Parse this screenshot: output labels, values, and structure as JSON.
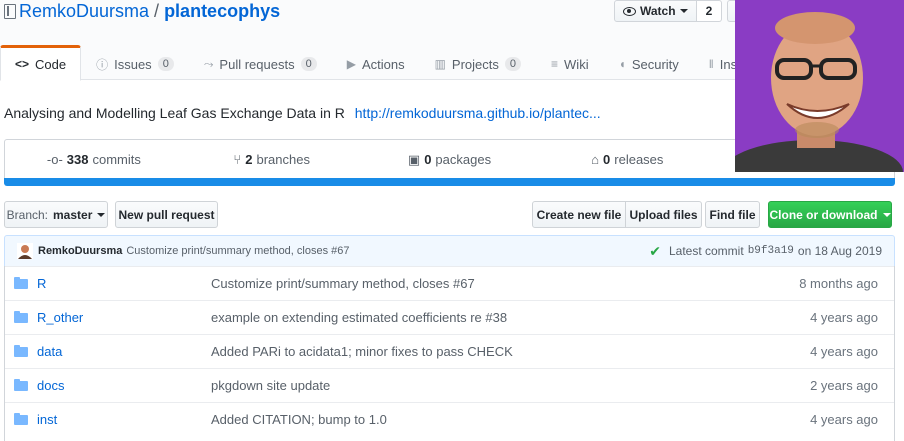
{
  "repo": {
    "owner": "RemkoDuursma",
    "separator": "/",
    "name": "plantecophys"
  },
  "watch": {
    "label": "Watch",
    "count": "2"
  },
  "tabs": [
    {
      "icon": "<>",
      "label": "Code",
      "counter": ""
    },
    {
      "icon": "ⓘ",
      "label": "Issues",
      "counter": "0"
    },
    {
      "icon": "⤳",
      "label": "Pull requests",
      "counter": "0"
    },
    {
      "icon": "▶",
      "label": "Actions",
      "counter": ""
    },
    {
      "icon": "▥",
      "label": "Projects",
      "counter": "0"
    },
    {
      "icon": "≡",
      "label": "Wiki",
      "counter": ""
    },
    {
      "icon": "◖",
      "label": "Security",
      "counter": ""
    },
    {
      "icon": "‖",
      "label": "Insights",
      "counter": ""
    }
  ],
  "description": {
    "text": "Analysing and Modelling Leaf Gas Exchange Data in R",
    "link": "http://remkoduursma.github.io/plantec..."
  },
  "summary": {
    "commits": {
      "count": "338",
      "label": "commits"
    },
    "branches": {
      "count": "2",
      "label": "branches"
    },
    "packages": {
      "count": "0",
      "label": "packages"
    },
    "releases": {
      "count": "0",
      "label": "releases"
    }
  },
  "toolbar": {
    "branch_prefix": "Branch:",
    "branch_name": "master",
    "new_pull_request": "New pull request",
    "create_new_file": "Create new file",
    "upload_files": "Upload files",
    "find_file": "Find file",
    "clone_download": "Clone or download"
  },
  "latest_commit": {
    "author": "RemkoDuursma",
    "message": "Customize print/summary method, closes #67",
    "label": "Latest commit",
    "sha": "b9f3a19",
    "date": "on 18 Aug 2019"
  },
  "files": [
    {
      "name": "R",
      "message": "Customize print/summary method, closes #67",
      "age": "8 months ago"
    },
    {
      "name": "R_other",
      "message": "example on extending estimated coefficients re #38",
      "age": "4 years ago"
    },
    {
      "name": "data",
      "message": "Added PARi to acidata1; minor fixes to pass CHECK",
      "age": "4 years ago"
    },
    {
      "name": "docs",
      "message": "pkgdown site update",
      "age": "2 years ago"
    },
    {
      "name": "inst",
      "message": "Added CITATION; bump to 1.0",
      "age": "4 years ago"
    }
  ],
  "colors": {
    "link": "#0366d6",
    "accent_tab": "#e36209",
    "green": "#28a745",
    "language_bar": "#198ce7",
    "photo_bg": "#8a3cc4"
  }
}
